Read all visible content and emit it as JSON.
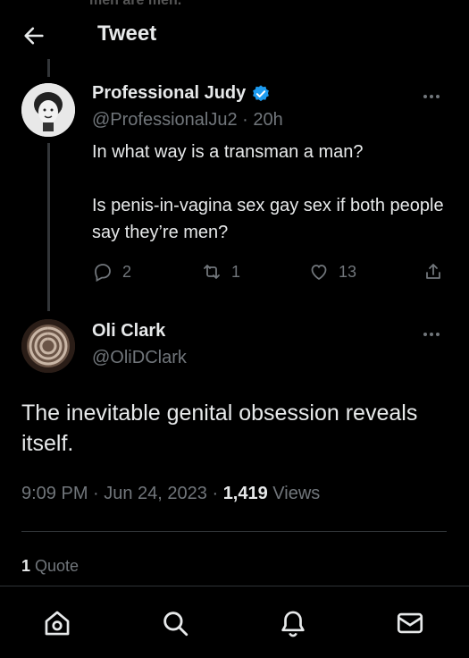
{
  "header": {
    "title": "Tweet",
    "cut_text": "men are men."
  },
  "reply_tweet": {
    "author_name": "Professional Judy",
    "verified": true,
    "handle_time": "@ProfessionalJu2 · 20h",
    "text_line1": "In what way is a transman a man?",
    "text_line2": "Is penis-in-vagina sex gay sex if both people say they’re men?",
    "replies": "2",
    "retweets": "1",
    "likes": "13"
  },
  "main_tweet": {
    "author_name": "Oli Clark",
    "handle": "@OliDClark",
    "text": "The inevitable genital obsession reveals itself.",
    "timestamp": "9:09 PM · Jun 24, 2023 · ",
    "views_count": "1,419",
    "views_label": " Views",
    "quote_count": "1",
    "quote_label": " Quote"
  },
  "colors": {
    "background": "#000000",
    "text": "#e7e9ea",
    "muted": "#71767b",
    "verified": "#1d9bf0"
  },
  "nav": [
    "home-icon",
    "search-icon",
    "notifications-icon",
    "messages-icon"
  ]
}
